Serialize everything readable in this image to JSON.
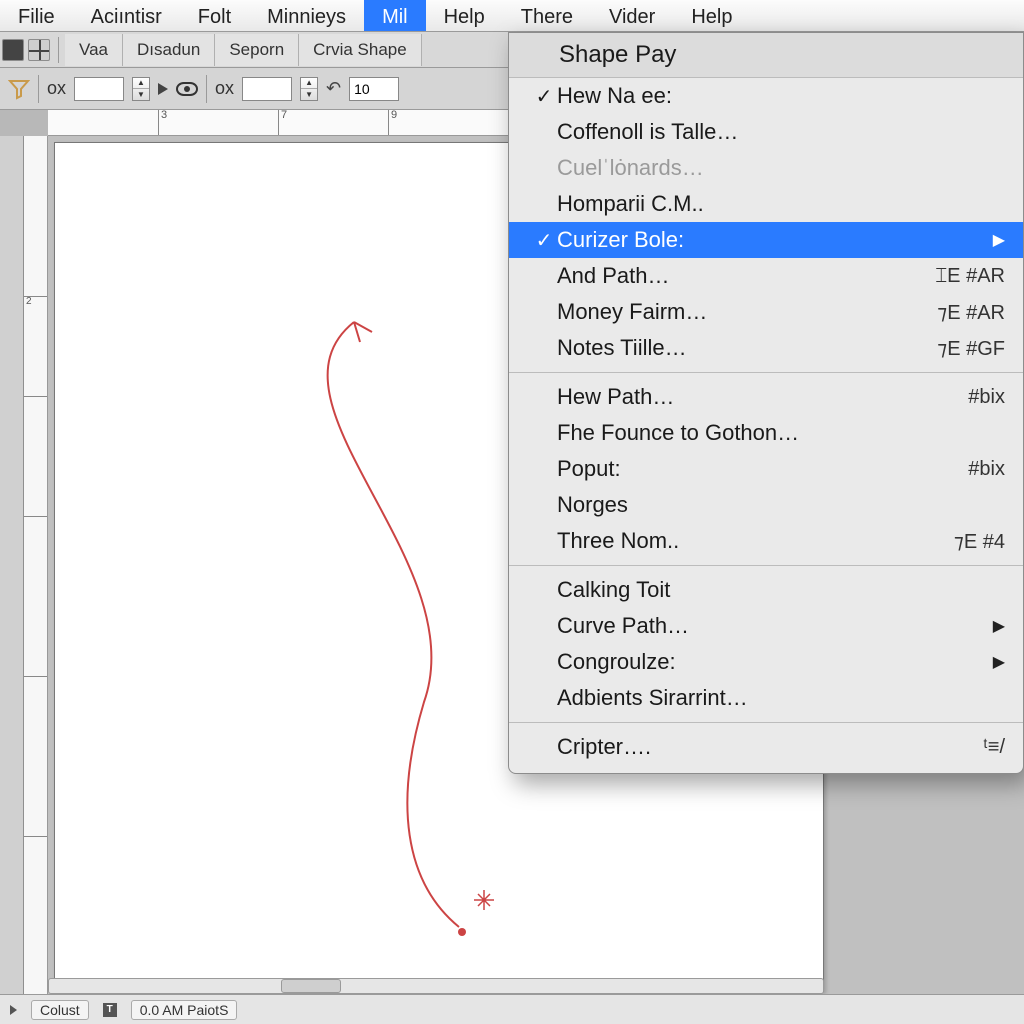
{
  "menubar": {
    "items": [
      {
        "label": "Filie"
      },
      {
        "label": "Aciıntisr"
      },
      {
        "label": "Folt"
      },
      {
        "label": "Minnieys"
      },
      {
        "label": "Mil",
        "active": true
      },
      {
        "label": "Help"
      },
      {
        "label": "There"
      },
      {
        "label": "Vider"
      },
      {
        "label": "Help"
      }
    ]
  },
  "toolstrip": {
    "tabs": [
      "Vaa",
      "Dısadun",
      "Seporn",
      "Crvia Shape"
    ]
  },
  "optionbar": {
    "label1": "ox",
    "field1": "",
    "label2": "ox",
    "field2": "",
    "field3": "10"
  },
  "ruler_top": {
    "marks": [
      {
        "pos": 110,
        "label": "3"
      },
      {
        "pos": 230,
        "label": "7"
      },
      {
        "pos": 340,
        "label": "9"
      }
    ]
  },
  "ruler_left": {
    "marks": [
      {
        "pos": 160,
        "label": "2"
      },
      {
        "pos": 260,
        "label": ""
      },
      {
        "pos": 380,
        "label": ""
      },
      {
        "pos": 540,
        "label": ""
      },
      {
        "pos": 700,
        "label": ""
      }
    ]
  },
  "dropdown": {
    "header": "Shape Pay",
    "groups": [
      [
        {
          "check": true,
          "label": "Hew Na ee:",
          "shortcut": "",
          "arrow": false
        },
        {
          "check": false,
          "label": "Coffenoll is Talle…",
          "shortcut": "",
          "arrow": false
        },
        {
          "check": false,
          "label": "Cuelˈlȯnards…",
          "shortcut": "",
          "arrow": false,
          "disabled": true
        },
        {
          "check": false,
          "label": "Homparii C.M..",
          "shortcut": "",
          "arrow": false
        },
        {
          "check": true,
          "label": "Curizer Bole:",
          "shortcut": "",
          "arrow": true,
          "selected": true
        },
        {
          "check": false,
          "label": "And Path…",
          "shortcut": "⌶E #AR",
          "arrow": false
        },
        {
          "check": false,
          "label": "Money Fairm…",
          "shortcut": "⁊E #AR",
          "arrow": false
        },
        {
          "check": false,
          "label": "Notes Tiille…",
          "shortcut": "⁊E #GF",
          "arrow": false
        }
      ],
      [
        {
          "check": false,
          "label": "Hew Path…",
          "shortcut": "#bix",
          "arrow": false
        },
        {
          "check": false,
          "label": "Fhe Founce to Gothon…",
          "shortcut": "",
          "arrow": false
        },
        {
          "check": false,
          "label": "Poput:",
          "shortcut": "#bix",
          "arrow": false
        },
        {
          "check": false,
          "label": "Norges",
          "shortcut": "",
          "arrow": false
        },
        {
          "check": false,
          "label": "Three Nom..",
          "shortcut": "⁊E #4",
          "arrow": false
        }
      ],
      [
        {
          "check": false,
          "label": "Calking Toit",
          "shortcut": "",
          "arrow": false
        },
        {
          "check": false,
          "label": "Curve Path…",
          "shortcut": "",
          "arrow": true
        },
        {
          "check": false,
          "label": "Congroulze:",
          "shortcut": "",
          "arrow": true
        },
        {
          "check": false,
          "label": "Adbients Sirarrint…",
          "shortcut": "",
          "arrow": false
        }
      ],
      [
        {
          "check": false,
          "label": "Cripter….",
          "shortcut": "ᵗ≡/",
          "arrow": false
        }
      ]
    ]
  },
  "statusbar": {
    "left": "Colust",
    "right": "0.0 AM PaiotS"
  }
}
